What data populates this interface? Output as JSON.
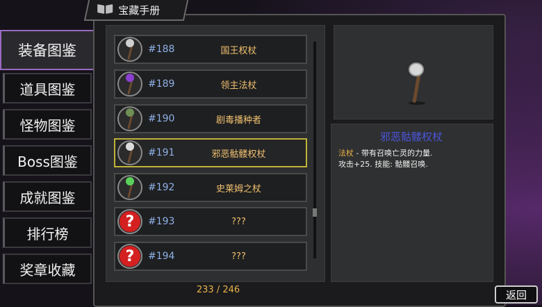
{
  "header": {
    "title": "宝藏手册",
    "icon": "book-icon"
  },
  "sidebar": {
    "items": [
      {
        "label": "装备图鉴",
        "active": true
      },
      {
        "label": "道具图鉴",
        "active": false
      },
      {
        "label": "怪物图鉴",
        "active": false
      },
      {
        "label": "Boss图鉴",
        "active": false
      },
      {
        "label": "成就图鉴",
        "active": false
      },
      {
        "label": "排行榜",
        "active": false
      },
      {
        "label": "奖章收藏",
        "active": false
      }
    ]
  },
  "list": {
    "rows": [
      {
        "number": "#188",
        "name": "国王权杖",
        "icon": "skull-staff-icon",
        "head_color": "#cfcfcf"
      },
      {
        "number": "#189",
        "name": "领主法杖",
        "icon": "purple-staff-icon",
        "head_color": "#8a3fd0"
      },
      {
        "number": "#190",
        "name": "剧毒播种者",
        "icon": "vine-staff-icon",
        "head_color": "#6f8f55"
      },
      {
        "number": "#191",
        "name": "邪恶骷髅权杖",
        "icon": "skull-staff-icon",
        "head_color": "#dcdcdc",
        "selected": true
      },
      {
        "number": "#192",
        "name": "史莱姆之杖",
        "icon": "slime-staff-icon",
        "head_color": "#5bd15b"
      },
      {
        "number": "#193",
        "name": "???",
        "icon": "unknown-icon",
        "unknown": true
      },
      {
        "number": "#194",
        "name": "???",
        "icon": "unknown-icon",
        "unknown": true
      }
    ],
    "counter": "233 / 246"
  },
  "detail": {
    "title": "邪恶骷髅权杖",
    "category": "法杖",
    "line1": " - 带有召唤亡灵的力量.",
    "line2": "攻击+25. 技能: 骷髅召唤."
  },
  "back_button": {
    "label": "返回"
  },
  "colors": {
    "selected_border": "#c2b33a",
    "number": "#8fb0e8",
    "name": "#f0c070",
    "title": "#4a55d8"
  }
}
